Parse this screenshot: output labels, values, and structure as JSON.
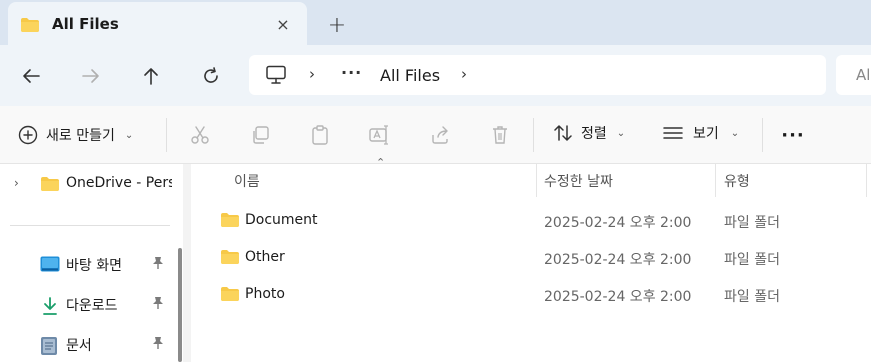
{
  "tab": {
    "title": "All Files",
    "close_icon": "×",
    "new_icon": "+"
  },
  "nav": {
    "breadcrumb": {
      "more": "···",
      "current": "All Files"
    },
    "search_placeholder": "Al"
  },
  "commands": {
    "new_label": "새로 만들기",
    "sort_label": "정렬",
    "view_label": "보기",
    "more_label": "···"
  },
  "sidebar": {
    "items": [
      {
        "label": "OneDrive - Pers"
      },
      {
        "label": "바탕 화면"
      },
      {
        "label": "다운로드"
      },
      {
        "label": "문서"
      }
    ]
  },
  "columns": {
    "name": "이름",
    "date": "수정한 날짜",
    "type": "유형"
  },
  "files": [
    {
      "name": "Document",
      "date": "2025-02-24 오후 2:00",
      "type": "파일 폴더"
    },
    {
      "name": "Other",
      "date": "2025-02-24 오후 2:00",
      "type": "파일 폴더"
    },
    {
      "name": "Photo",
      "date": "2025-02-24 오후 2:00",
      "type": "파일 폴더"
    }
  ],
  "colors": {
    "folder": "#f7c948",
    "accent": "#0067c0",
    "tabstrip": "#dbe5f1"
  }
}
